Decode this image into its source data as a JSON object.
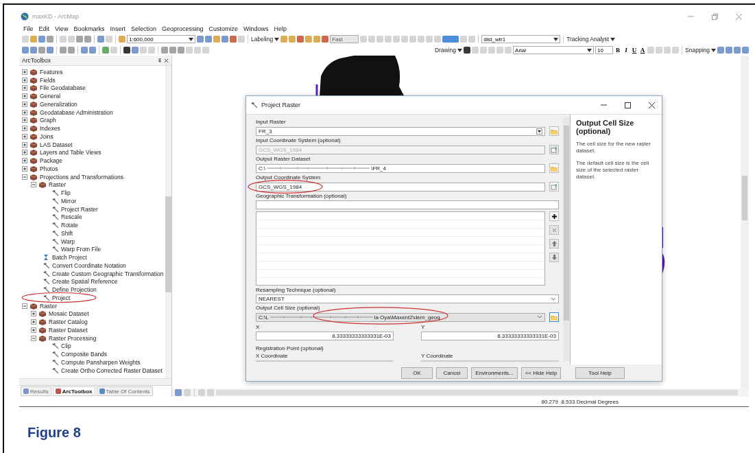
{
  "window": {
    "title": "maxKD - ArcMap"
  },
  "menu": [
    "File",
    "Edit",
    "View",
    "Bookmarks",
    "Insert",
    "Selection",
    "Geoprocessing",
    "Customize",
    "Windows",
    "Help"
  ],
  "toolbar": {
    "scale": "1:600,000",
    "labeling": "Labeling",
    "label_quality": "Fast",
    "layer": "dist_wtr1",
    "tracking": "Tracking Analyst",
    "drawing": "Drawing",
    "font": "Arial",
    "font_size": "10",
    "bold": "B",
    "italic": "I",
    "underline": "U",
    "font_color": "A",
    "snapping": "Snapping"
  },
  "toolbox": {
    "title": "ArcToolbox",
    "items": [
      {
        "label": "Features",
        "kind": "toolset",
        "expanded": false,
        "circled": false
      },
      {
        "label": "Fields",
        "kind": "toolset",
        "expanded": false,
        "circled": false
      },
      {
        "label": "File Geodatabase",
        "kind": "toolset",
        "expanded": false,
        "circled": false
      },
      {
        "label": "General",
        "kind": "toolset",
        "expanded": false,
        "circled": false
      },
      {
        "label": "Generalization",
        "kind": "toolset",
        "expanded": false,
        "circled": false
      },
      {
        "label": "Geodatabase Administration",
        "kind": "toolset",
        "expanded": false,
        "circled": false
      },
      {
        "label": "Graph",
        "kind": "toolset",
        "expanded": false,
        "circled": false
      },
      {
        "label": "Indexes",
        "kind": "toolset",
        "expanded": false,
        "circled": false
      },
      {
        "label": "Joins",
        "kind": "toolset",
        "expanded": false,
        "circled": false
      },
      {
        "label": "LAS Dataset",
        "kind": "toolset",
        "expanded": false,
        "circled": false
      },
      {
        "label": "Layers and Table Views",
        "kind": "toolset",
        "expanded": false,
        "circled": false
      },
      {
        "label": "Package",
        "kind": "toolset",
        "expanded": false,
        "circled": false
      },
      {
        "label": "Photos",
        "kind": "toolset",
        "expanded": false,
        "circled": false
      },
      {
        "label": "Projections and Transformations",
        "kind": "toolset",
        "expanded": true,
        "circled": false,
        "children": [
          {
            "label": "Raster",
            "kind": "toolset",
            "expanded": true,
            "circled": false,
            "children": [
              {
                "label": "Flip",
                "kind": "tool",
                "circled": false
              },
              {
                "label": "Mirror",
                "kind": "tool",
                "circled": false
              },
              {
                "label": "Project Raster",
                "kind": "tool",
                "circled": false
              },
              {
                "label": "Rescale",
                "kind": "tool",
                "circled": false
              },
              {
                "label": "Rotate",
                "kind": "tool",
                "circled": false
              },
              {
                "label": "Shift",
                "kind": "tool",
                "circled": false
              },
              {
                "label": "Warp",
                "kind": "tool",
                "circled": false
              },
              {
                "label": "Warp From File",
                "kind": "tool",
                "circled": false
              }
            ]
          },
          {
            "label": "Batch Project",
            "kind": "batch",
            "circled": false
          },
          {
            "label": "Convert Coordinate Notation",
            "kind": "tool",
            "circled": false
          },
          {
            "label": "Create Custom Geographic Transformation",
            "kind": "tool",
            "circled": false
          },
          {
            "label": "Create Spatial Reference",
            "kind": "tool",
            "circled": false
          },
          {
            "label": "Define Projection",
            "kind": "tool",
            "circled": false
          },
          {
            "label": "Project",
            "kind": "tool",
            "circled": true
          }
        ]
      },
      {
        "label": "Raster",
        "kind": "toolset",
        "expanded": true,
        "circled": false,
        "children": [
          {
            "label": "Mosaic Dataset",
            "kind": "toolset",
            "expanded": false,
            "circled": false
          },
          {
            "label": "Raster Catalog",
            "kind": "toolset",
            "expanded": false,
            "circled": false
          },
          {
            "label": "Raster Dataset",
            "kind": "toolset",
            "expanded": false,
            "circled": false
          },
          {
            "label": "Raster Processing",
            "kind": "toolset",
            "expanded": true,
            "circled": false,
            "children": [
              {
                "label": "Clip",
                "kind": "tool",
                "circled": false
              },
              {
                "label": "Composite Bands",
                "kind": "tool",
                "circled": false
              },
              {
                "label": "Compute Pansharpen Weights",
                "kind": "tool",
                "circled": false
              },
              {
                "label": "Create Ortho Corrected Raster Dataset",
                "kind": "tool",
                "circled": false
              }
            ]
          }
        ]
      }
    ]
  },
  "panel_tabs": [
    {
      "label": "Results",
      "selected": false
    },
    {
      "label": "ArcToolbox",
      "selected": true
    },
    {
      "label": "Table Of Contents",
      "selected": false
    }
  ],
  "dialog": {
    "title": "Project Raster",
    "fields": [
      {
        "kind": "combo",
        "label": "Input Raster",
        "value": "FR_3",
        "disabled": false,
        "circled": false
      },
      {
        "kind": "text",
        "label": "Input Coordinate System (optional)",
        "value": "GCS_WGS_1984",
        "disabled": true,
        "circled": false
      },
      {
        "kind": "path",
        "label": "Output Raster Dataset",
        "value_start": "C:\\",
        "value_end": "\\FR_4",
        "disabled": false,
        "circled": false
      },
      {
        "kind": "text",
        "label": "Output Coordinate System",
        "value": "GCS_WGS_1984",
        "disabled": false,
        "circled": true
      },
      {
        "kind": "list",
        "label": "Geographic Transformation (optional)",
        "circled": false
      },
      {
        "kind": "dropdown",
        "label": "Resampling Technique (optional)",
        "value": "NEAREST",
        "disabled": false,
        "circled": false
      },
      {
        "kind": "path_dropdown",
        "label": "Output Cell Size (optional)",
        "value_start": "C:\\L",
        "value_end": "la Oya\\Maxent2\\dem_geog",
        "disabled": false,
        "circled": true
      },
      {
        "kind": "xy",
        "x_label": "X",
        "x_value": "8.33333333333331E-03",
        "y_label": "Y",
        "y_value": "8.33333333333331E-03",
        "disabled": false,
        "circled": false
      },
      {
        "kind": "section",
        "label": "Registration Point (optional)",
        "x_label": "X Coordinate",
        "y_label": "Y Coordinate",
        "circled": false
      }
    ],
    "buttons": [
      "OK",
      "Cancel",
      "Environments...",
      "<< Hide Help",
      "Tool Help"
    ],
    "help": {
      "title": "Output Cell Size (optional)",
      "paragraphs": [
        "The cell size for the new raster dataset.",
        "The default cell size is the cell size of the selected raster dataset."
      ]
    }
  },
  "status_bar": {
    "coordinates": "80.279  8.533 Decimal Degrees"
  },
  "caption": "Figure 8"
}
